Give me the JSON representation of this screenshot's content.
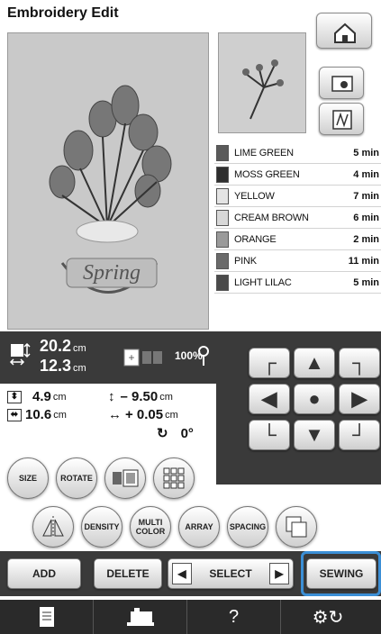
{
  "header": {
    "title": "Embroidery Edit"
  },
  "threads": [
    {
      "name": "LIME GREEN",
      "time": "5 min",
      "color": "#5a5a5a"
    },
    {
      "name": "MOSS GREEN",
      "time": "4 min",
      "color": "#2e2e2e"
    },
    {
      "name": "YELLOW",
      "time": "7 min",
      "color": "#e4e4e4"
    },
    {
      "name": "CREAM BROWN",
      "time": "6 min",
      "color": "#d8d8d8"
    },
    {
      "name": "ORANGE",
      "time": "2 min",
      "color": "#9a9a9a"
    },
    {
      "name": "PINK",
      "time": "11 min",
      "color": "#6a6a6a"
    },
    {
      "name": "LIGHT LILAC",
      "time": "5 min",
      "color": "#4a4a4a"
    }
  ],
  "size_info": {
    "height": "20.2",
    "width": "12.3",
    "unit": "cm",
    "zoom": "100%"
  },
  "position_info": {
    "v_size": "4.9",
    "h_size": "10.6",
    "v_offset": "– 9.50",
    "h_offset": "+ 0.05",
    "unit": "cm",
    "angle": "0°"
  },
  "buttons": {
    "size": "SIZE",
    "rotate": "ROTATE",
    "density": "DENSITY",
    "multi_color": "MULTI COLOR",
    "array": "ARRAY",
    "spacing": "SPACING",
    "add": "ADD",
    "delete": "DELETE",
    "select": "SELECT",
    "sewing": "SEWING"
  },
  "footer": {
    "help": "?"
  }
}
